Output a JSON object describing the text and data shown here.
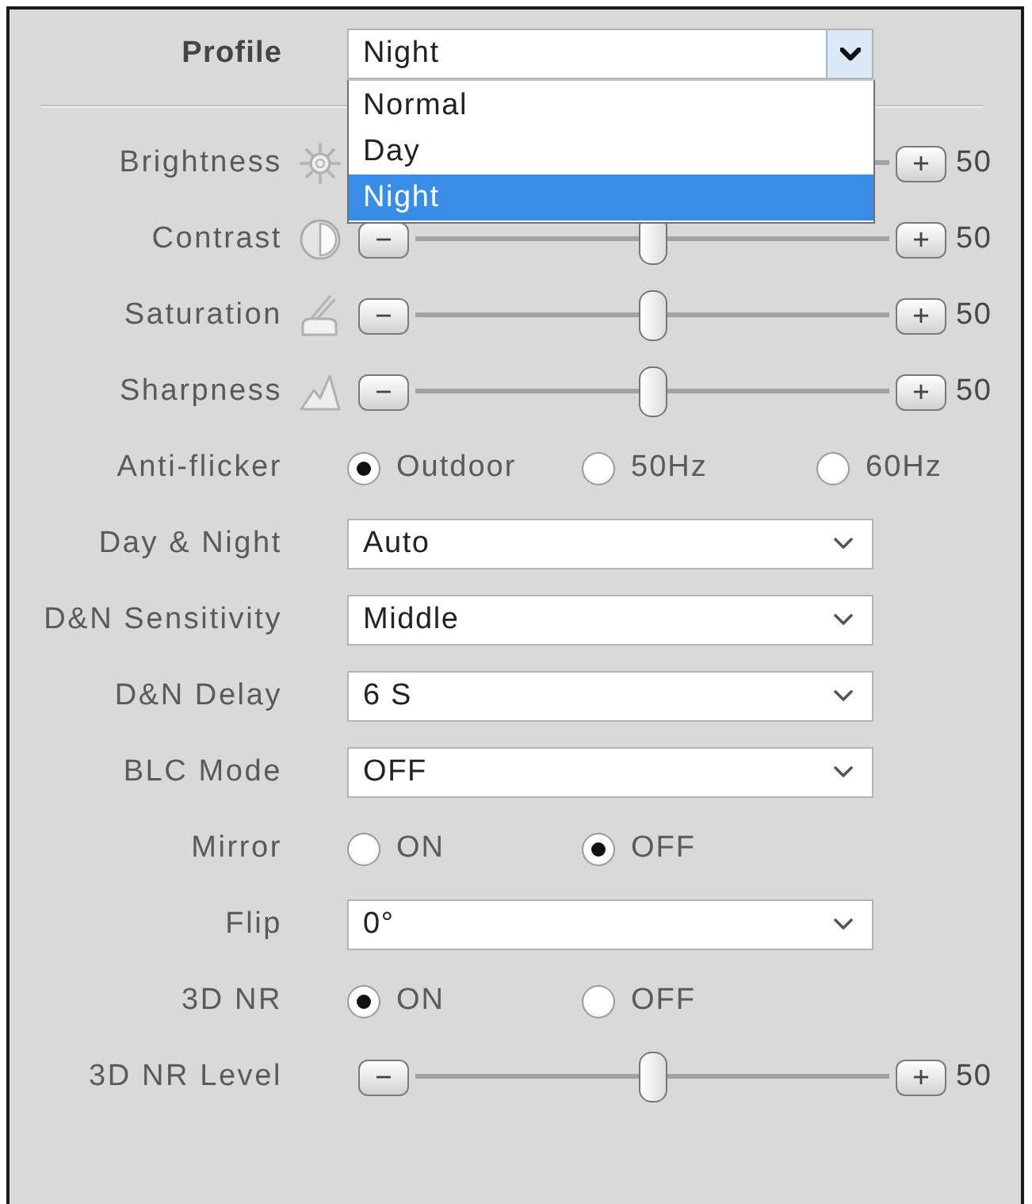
{
  "profile": {
    "label": "Profile",
    "value": "Night",
    "expanded": true,
    "options": [
      {
        "label": "Normal",
        "selected": false
      },
      {
        "label": "Day",
        "selected": false
      },
      {
        "label": "Night",
        "selected": true
      }
    ]
  },
  "rows": [
    {
      "kind": "slider",
      "label": "Brightness",
      "reading": "50"
    },
    {
      "kind": "slider",
      "label": "Contrast",
      "level": 0.5,
      "reading": "50"
    },
    {
      "kind": "slider",
      "label": "Saturation",
      "level": 0.5,
      "reading": "50"
    },
    {
      "kind": "slider",
      "label": "Sharpness",
      "level": 0.5,
      "reading": "50"
    },
    {
      "kind": "radio",
      "label": "Anti-flicker",
      "options": [
        {
          "label": "Outdoor",
          "selected": true
        },
        {
          "label": "50Hz",
          "selected": false
        },
        {
          "label": "60Hz",
          "selected": false
        }
      ]
    },
    {
      "kind": "select",
      "label": "Day & Night",
      "value": "Auto"
    },
    {
      "kind": "select",
      "label": "D&N Sensitivity",
      "value": "Middle"
    },
    {
      "kind": "select",
      "label": "D&N Delay",
      "value": "6 S"
    },
    {
      "kind": "select",
      "label": "BLC Mode",
      "value": "OFF"
    },
    {
      "kind": "radio",
      "label": "Mirror",
      "options": [
        {
          "label": "ON",
          "selected": false
        },
        {
          "label": "OFF",
          "selected": true
        }
      ]
    },
    {
      "kind": "select",
      "label": "Flip",
      "value": "0°"
    },
    {
      "kind": "radio",
      "label": "3D NR",
      "options": [
        {
          "label": "ON",
          "selected": true
        },
        {
          "label": "OFF",
          "selected": false
        }
      ]
    },
    {
      "kind": "slider",
      "label": "3D NR Level",
      "level": 0.5,
      "reading": "50"
    }
  ]
}
